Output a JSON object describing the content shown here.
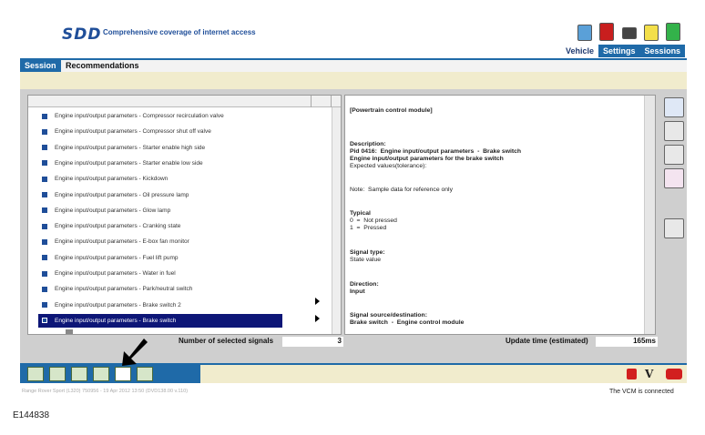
{
  "header": {
    "logo": "SDD",
    "tagline": "Comprehensive coverage of internet access",
    "nav": [
      "Vehicle",
      "Settings",
      "Sessions"
    ]
  },
  "tabs": [
    "Session",
    "Recommendations"
  ],
  "signal_list": {
    "rows": [
      "Engine input/output parameters  -  Compressor recirculation valve",
      "Engine input/output parameters  -  Compressor shut off valve",
      "Engine input/output parameters  -  Starter enable high side",
      "Engine input/output parameters  -  Starter enable low side",
      "Engine input/output parameters  -  Kickdown",
      "Engine input/output parameters  -  Oil pressure lamp",
      "Engine input/output parameters  -  Glow lamp",
      "Engine input/output parameters  -  Cranking state",
      "Engine input/output parameters  -  E-box fan monitor",
      "Engine input/output parameters  -  Fuel lift pump",
      "Engine input/output parameters  -  Water in fuel",
      "Engine input/output parameters  -  Park/neutral switch",
      "Engine input/output parameters  -  Brake switch 2",
      "Engine input/output parameters  -  Brake switch"
    ],
    "selected_index": 13
  },
  "details": {
    "module": "[Powertrain control module]",
    "description_label": "Description:",
    "description_lines": [
      "Pid 0416:  Engine input/output parameters  -  Brake switch",
      "Engine input/output parameters for the brake switch",
      "Expected values(tolerance):"
    ],
    "note": "Note:  Sample data for reference only",
    "typical_label": "Typical",
    "typical_lines": [
      "0  =  Not pressed",
      "1  =  Pressed"
    ],
    "signal_type_label": "Signal type:",
    "signal_type": "State value",
    "direction_label": "Direction:",
    "direction": "Input",
    "source_label": "Signal source/destination:",
    "source": "Brake switch  -  Engine control module"
  },
  "info_bar": {
    "selected_label": "Number of selected signals",
    "selected_value": "3",
    "update_label": "Update time (estimated)",
    "update_value": "165ms"
  },
  "footer": {
    "status_line": "Range Rover Sport (L320) 750956 - 19 Apr 2012 13:50 (DVD138.00 v.110)",
    "vcm_status": "The VCM is connected",
    "figure_id": "E144838"
  }
}
